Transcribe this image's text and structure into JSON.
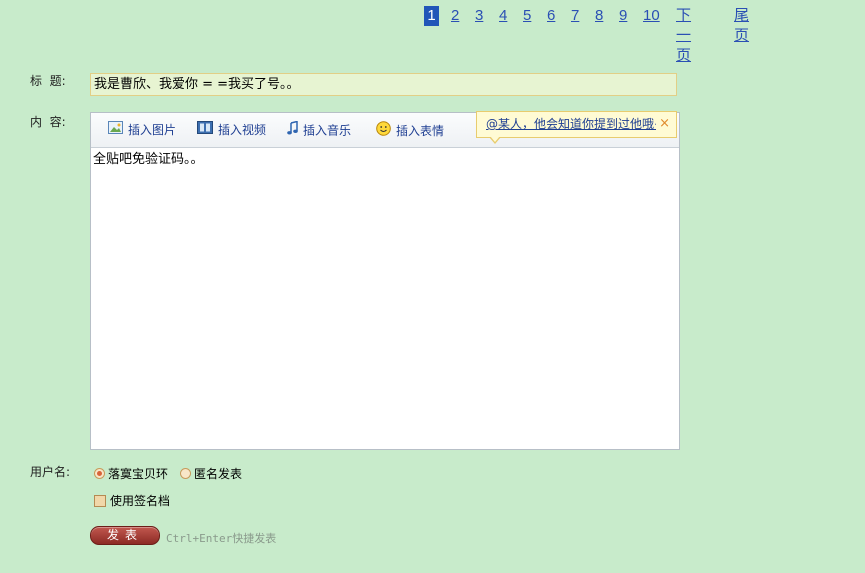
{
  "pagination": {
    "pages": [
      "1",
      "2",
      "3",
      "4",
      "5",
      "6",
      "7",
      "8",
      "9",
      "10"
    ],
    "current": "1",
    "next_label": "下一页",
    "last_label": "尾页"
  },
  "form": {
    "title_label": "标  题:",
    "title_value": "我是曹欣、我爱你 = =我买了号。。",
    "content_label": "内  容:",
    "content_value": "全贴吧免验证码。。",
    "username_label": "用户名:"
  },
  "toolbar": {
    "insert_image": "插入图片",
    "insert_video": "插入视频",
    "insert_music": "插入音乐",
    "insert_emoji": "插入表情"
  },
  "tooltip": {
    "text": "@某人，他会知道你提到过他哦~",
    "close": "×"
  },
  "identity": {
    "option_user": "落寞宝贝环",
    "option_anonymous": "匿名发表",
    "selected": "option_user",
    "signature_label": "使用签名档"
  },
  "submit": {
    "label": "发表",
    "hint": "Ctrl+Enter快捷发表"
  },
  "colors": {
    "background": "#c8ebcb",
    "link": "#2a4fb4",
    "pager_current": "#2156b8",
    "submit": "#a63a33"
  }
}
